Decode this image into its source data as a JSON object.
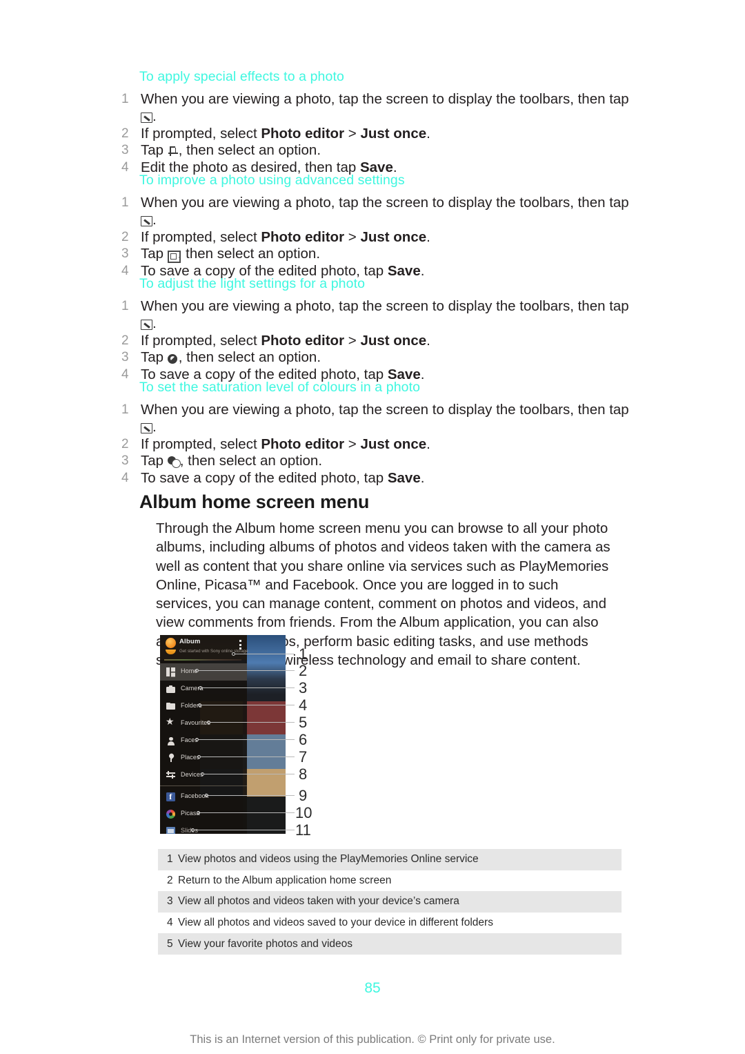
{
  "procedures": [
    {
      "title": "To apply special effects to a photo",
      "steps": [
        {
          "num": "1",
          "pre": "When you are viewing a photo, tap the screen to display the toolbars, then tap ",
          "icon": "edit-icon",
          "post": "."
        },
        {
          "num": "2",
          "pre": "If prompted, select ",
          "bold1": "Photo editor",
          "mid": " > ",
          "bold2": "Just once",
          "post": "."
        },
        {
          "num": "3",
          "pre": "Tap ",
          "icon": "crop-icon",
          "post": ", then select an option."
        },
        {
          "num": "4",
          "pre": "Edit the photo as desired, then tap ",
          "bold1": "Save",
          "post": "."
        }
      ]
    },
    {
      "title": "To improve a photo using advanced settings",
      "steps": [
        {
          "num": "1",
          "pre": "When you are viewing a photo, tap the screen to display the toolbars, then tap ",
          "icon": "edit-icon",
          "post": "."
        },
        {
          "num": "2",
          "pre": "If prompted, select ",
          "bold1": "Photo editor",
          "mid": " > ",
          "bold2": "Just once",
          "post": "."
        },
        {
          "num": "3",
          "pre": "Tap ",
          "icon": "frame-icon",
          "post": ", then select an option."
        },
        {
          "num": "4",
          "pre": "To save a copy of the edited photo, tap ",
          "bold1": "Save",
          "post": "."
        }
      ]
    },
    {
      "title": "To adjust the light settings for a photo",
      "steps": [
        {
          "num": "1",
          "pre": "When you are viewing a photo, tap the screen to display the toolbars, then tap ",
          "icon": "edit-icon",
          "post": "."
        },
        {
          "num": "2",
          "pre": "If prompted, select ",
          "bold1": "Photo editor",
          "mid": " > ",
          "bold2": "Just once",
          "post": "."
        },
        {
          "num": "3",
          "pre": "Tap ",
          "icon": "light-icon",
          "post": ", then select an option."
        },
        {
          "num": "4",
          "pre": "To save a copy of the edited photo, tap ",
          "bold1": "Save",
          "post": "."
        }
      ]
    },
    {
      "title": "To set the saturation level of colours in a photo",
      "steps": [
        {
          "num": "1",
          "pre": "When you are viewing a photo, tap the screen to display the toolbars, then tap ",
          "icon": "edit-icon",
          "post": "."
        },
        {
          "num": "2",
          "pre": "If prompted, select ",
          "bold1": "Photo editor",
          "mid": " > ",
          "bold2": "Just once",
          "post": "."
        },
        {
          "num": "3",
          "pre": "Tap ",
          "icon": "saturation-icon",
          "post": ", then select an option."
        },
        {
          "num": "4",
          "pre": "To save a copy of the edited photo, tap ",
          "bold1": "Save",
          "post": "."
        }
      ]
    }
  ],
  "section": {
    "heading": "Album home screen menu",
    "intro": "Through the Album home screen menu you can browse to all your photo albums, including albums of photos and videos taken with the camera as well as content that you share online via services such as PlayMemories Online, Picasa™ and Facebook. Once you are logged in to such services, you can manage content, comment on photos and videos, and view comments from friends. From the Album application, you can also add geotags to photos, perform basic editing tasks, and use methods such as Bluetooth® wireless technology and email to share content."
  },
  "figure": {
    "app_title": "Album",
    "app_subtitle": "Get started with Sony online storage",
    "menu_items": [
      {
        "label": "Home",
        "icon": "grid-icon",
        "selected": true
      },
      {
        "label": "Camera",
        "icon": "camera-icon",
        "selected": false
      },
      {
        "label": "Folders",
        "icon": "folder-icon",
        "selected": false
      },
      {
        "label": "Favourites",
        "icon": "star-icon",
        "selected": false
      },
      {
        "label": "Faces",
        "icon": "person-icon",
        "selected": false
      },
      {
        "label": "Places",
        "icon": "map-pin-icon",
        "selected": false
      },
      {
        "label": "Devices",
        "icon": "devices-icon",
        "selected": false
      },
      {
        "label": "Facebook",
        "icon": "facebook-icon",
        "selected": false
      },
      {
        "label": "Picasa",
        "icon": "picasa-icon",
        "selected": false
      },
      {
        "label": "Slides",
        "icon": "slides-icon",
        "selected": false
      }
    ],
    "callouts": [
      "1",
      "2",
      "3",
      "4",
      "5",
      "6",
      "7",
      "8",
      "9",
      "10",
      "11"
    ]
  },
  "legend": {
    "rows": [
      {
        "num": "1",
        "text": "View photos and videos using the PlayMemories Online service"
      },
      {
        "num": "2",
        "text": "Return to the Album application home screen"
      },
      {
        "num": "3",
        "text": "View all photos and videos taken with your device’s camera"
      },
      {
        "num": "4",
        "text": "View all photos and videos saved to your device in different folders"
      },
      {
        "num": "5",
        "text": "View your favorite photos and videos"
      }
    ]
  },
  "footer": {
    "page_number": "85",
    "copyright": "This is an Internet version of this publication. © Print only for private use."
  },
  "colors": {
    "heading_cyan": "#3FF7E0",
    "body_text": "#231f20",
    "list_number": "#9a9a9a",
    "legend_shaded": "#e6e6e6"
  }
}
